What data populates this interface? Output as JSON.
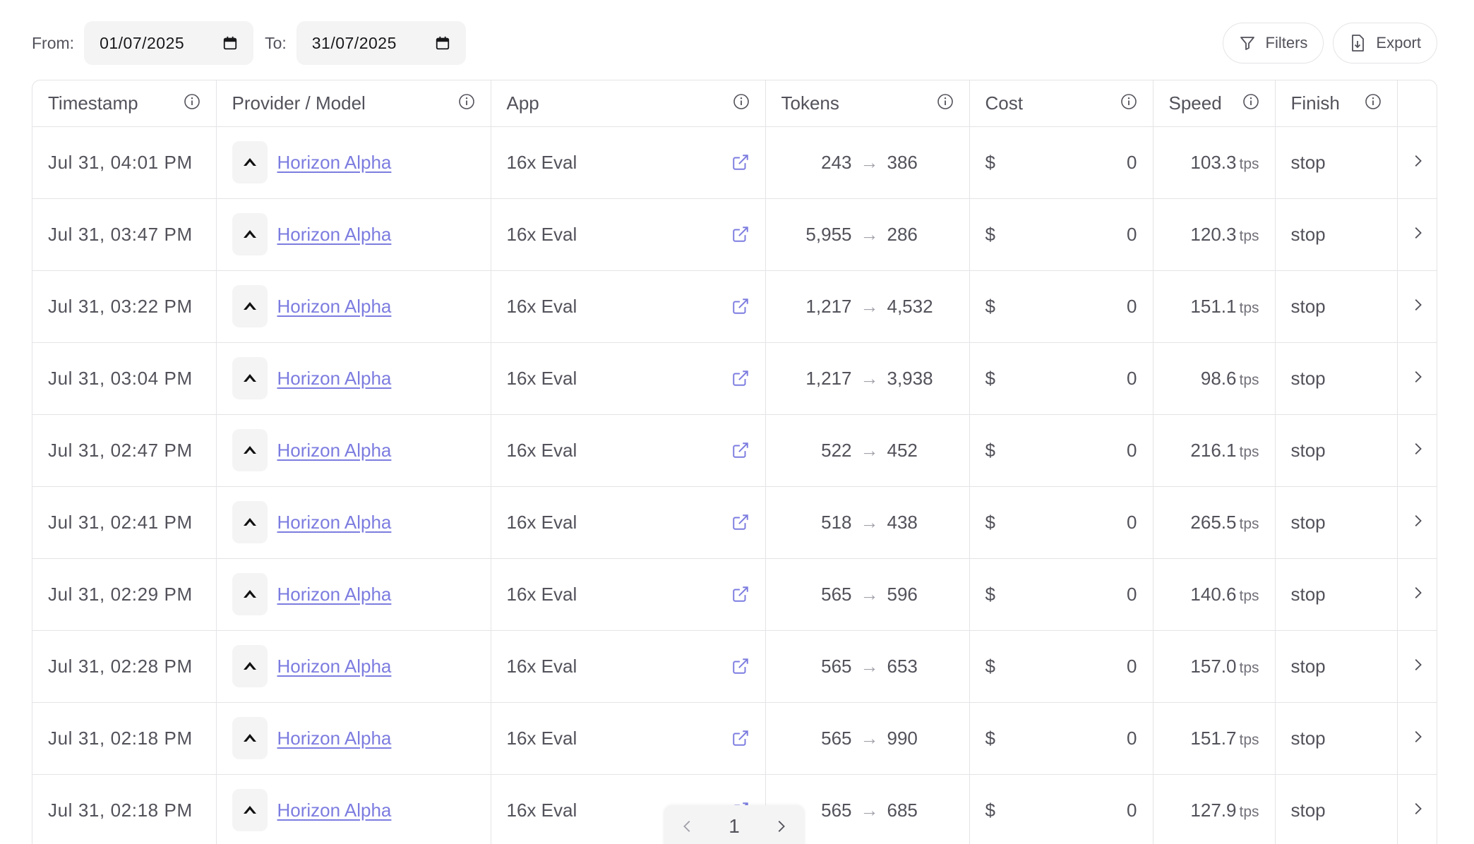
{
  "filters": {
    "from_label": "From:",
    "from_value": "01/07/2025",
    "to_label": "To:",
    "to_value": "31/07/2025",
    "filters_button": "Filters",
    "export_button": "Export"
  },
  "columns": [
    "Timestamp",
    "Provider / Model",
    "App",
    "Tokens",
    "Cost",
    "Speed",
    "Finish"
  ],
  "rows": [
    {
      "timestamp": "Jul 31, 04:01 PM",
      "model": "Horizon Alpha",
      "app": "16x Eval",
      "tokens_in": "243",
      "tokens_out": "386",
      "cost_symbol": "$",
      "cost": "0",
      "speed": "103.3",
      "speed_unit": "tps",
      "finish": "stop"
    },
    {
      "timestamp": "Jul 31, 03:47 PM",
      "model": "Horizon Alpha",
      "app": "16x Eval",
      "tokens_in": "5,955",
      "tokens_out": "286",
      "cost_symbol": "$",
      "cost": "0",
      "speed": "120.3",
      "speed_unit": "tps",
      "finish": "stop"
    },
    {
      "timestamp": "Jul 31, 03:22 PM",
      "model": "Horizon Alpha",
      "app": "16x Eval",
      "tokens_in": "1,217",
      "tokens_out": "4,532",
      "cost_symbol": "$",
      "cost": "0",
      "speed": "151.1",
      "speed_unit": "tps",
      "finish": "stop"
    },
    {
      "timestamp": "Jul 31, 03:04 PM",
      "model": "Horizon Alpha",
      "app": "16x Eval",
      "tokens_in": "1,217",
      "tokens_out": "3,938",
      "cost_symbol": "$",
      "cost": "0",
      "speed": "98.6",
      "speed_unit": "tps",
      "finish": "stop"
    },
    {
      "timestamp": "Jul 31, 02:47 PM",
      "model": "Horizon Alpha",
      "app": "16x Eval",
      "tokens_in": "522",
      "tokens_out": "452",
      "cost_symbol": "$",
      "cost": "0",
      "speed": "216.1",
      "speed_unit": "tps",
      "finish": "stop"
    },
    {
      "timestamp": "Jul 31, 02:41 PM",
      "model": "Horizon Alpha",
      "app": "16x Eval",
      "tokens_in": "518",
      "tokens_out": "438",
      "cost_symbol": "$",
      "cost": "0",
      "speed": "265.5",
      "speed_unit": "tps",
      "finish": "stop"
    },
    {
      "timestamp": "Jul 31, 02:29 PM",
      "model": "Horizon Alpha",
      "app": "16x Eval",
      "tokens_in": "565",
      "tokens_out": "596",
      "cost_symbol": "$",
      "cost": "0",
      "speed": "140.6",
      "speed_unit": "tps",
      "finish": "stop"
    },
    {
      "timestamp": "Jul 31, 02:28 PM",
      "model": "Horizon Alpha",
      "app": "16x Eval",
      "tokens_in": "565",
      "tokens_out": "653",
      "cost_symbol": "$",
      "cost": "0",
      "speed": "157.0",
      "speed_unit": "tps",
      "finish": "stop"
    },
    {
      "timestamp": "Jul 31, 02:18 PM",
      "model": "Horizon Alpha",
      "app": "16x Eval",
      "tokens_in": "565",
      "tokens_out": "990",
      "cost_symbol": "$",
      "cost": "0",
      "speed": "151.7",
      "speed_unit": "tps",
      "finish": "stop"
    },
    {
      "timestamp": "Jul 31, 02:18 PM",
      "model": "Horizon Alpha",
      "app": "16x Eval",
      "tokens_in": "565",
      "tokens_out": "685",
      "cost_symbol": "$",
      "cost": "0",
      "speed": "127.9",
      "speed_unit": "tps",
      "finish": "stop"
    }
  ],
  "pagination": {
    "current_page": "1"
  },
  "colors": {
    "link": "#7c7ce0",
    "border": "#e4e4e7",
    "input_bg": "#f4f4f5"
  },
  "icons": [
    "calendar-icon",
    "filter-icon",
    "export-icon",
    "info-icon",
    "external-link-icon",
    "chevron-right-icon",
    "chevron-left-icon",
    "provider-logo-icon"
  ]
}
